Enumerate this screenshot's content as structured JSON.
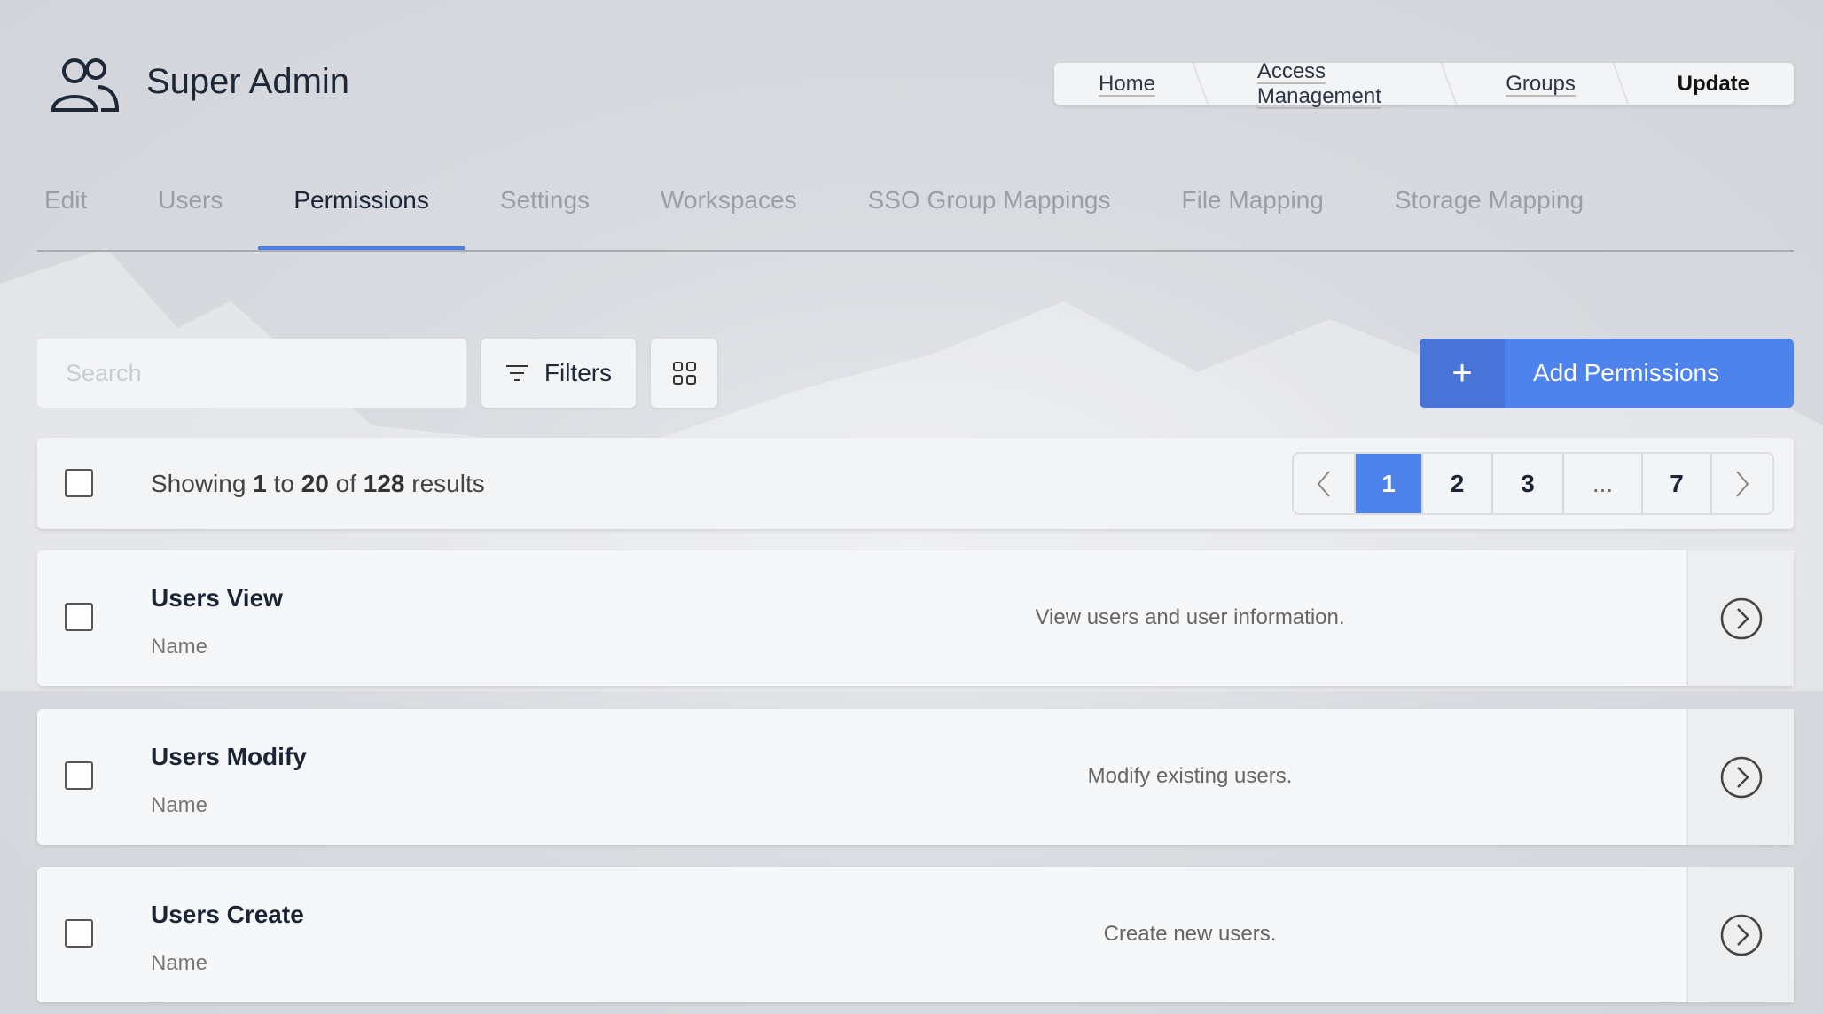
{
  "header": {
    "title": "Super Admin",
    "icon": "users-group-icon"
  },
  "breadcrumb": [
    "Home",
    "Access Management",
    "Groups",
    "Update"
  ],
  "tabs": [
    "Edit",
    "Users",
    "Permissions",
    "Settings",
    "Workspaces",
    "SSO Group Mappings",
    "File Mapping",
    "Storage Mapping"
  ],
  "active_tab": "Permissions",
  "toolbar": {
    "search_placeholder": "Search",
    "filters_label": "Filters",
    "add_label": "Add Permissions"
  },
  "results": {
    "prefix": "Showing",
    "from": "1",
    "to_word": "to",
    "to": "20",
    "of_word": "of",
    "total": "128",
    "suffix": "results"
  },
  "pagination": {
    "pages": [
      "1",
      "2",
      "3",
      "...",
      "7"
    ],
    "current": "1"
  },
  "rows": [
    {
      "title": "Users View",
      "subtitle": "Name",
      "description": "View users and user information."
    },
    {
      "title": "Users Modify",
      "subtitle": "Name",
      "description": "Modify existing users."
    },
    {
      "title": "Users Create",
      "subtitle": "Name",
      "description": "Create new users."
    }
  ],
  "colors": {
    "accent": "#4e82ec"
  }
}
